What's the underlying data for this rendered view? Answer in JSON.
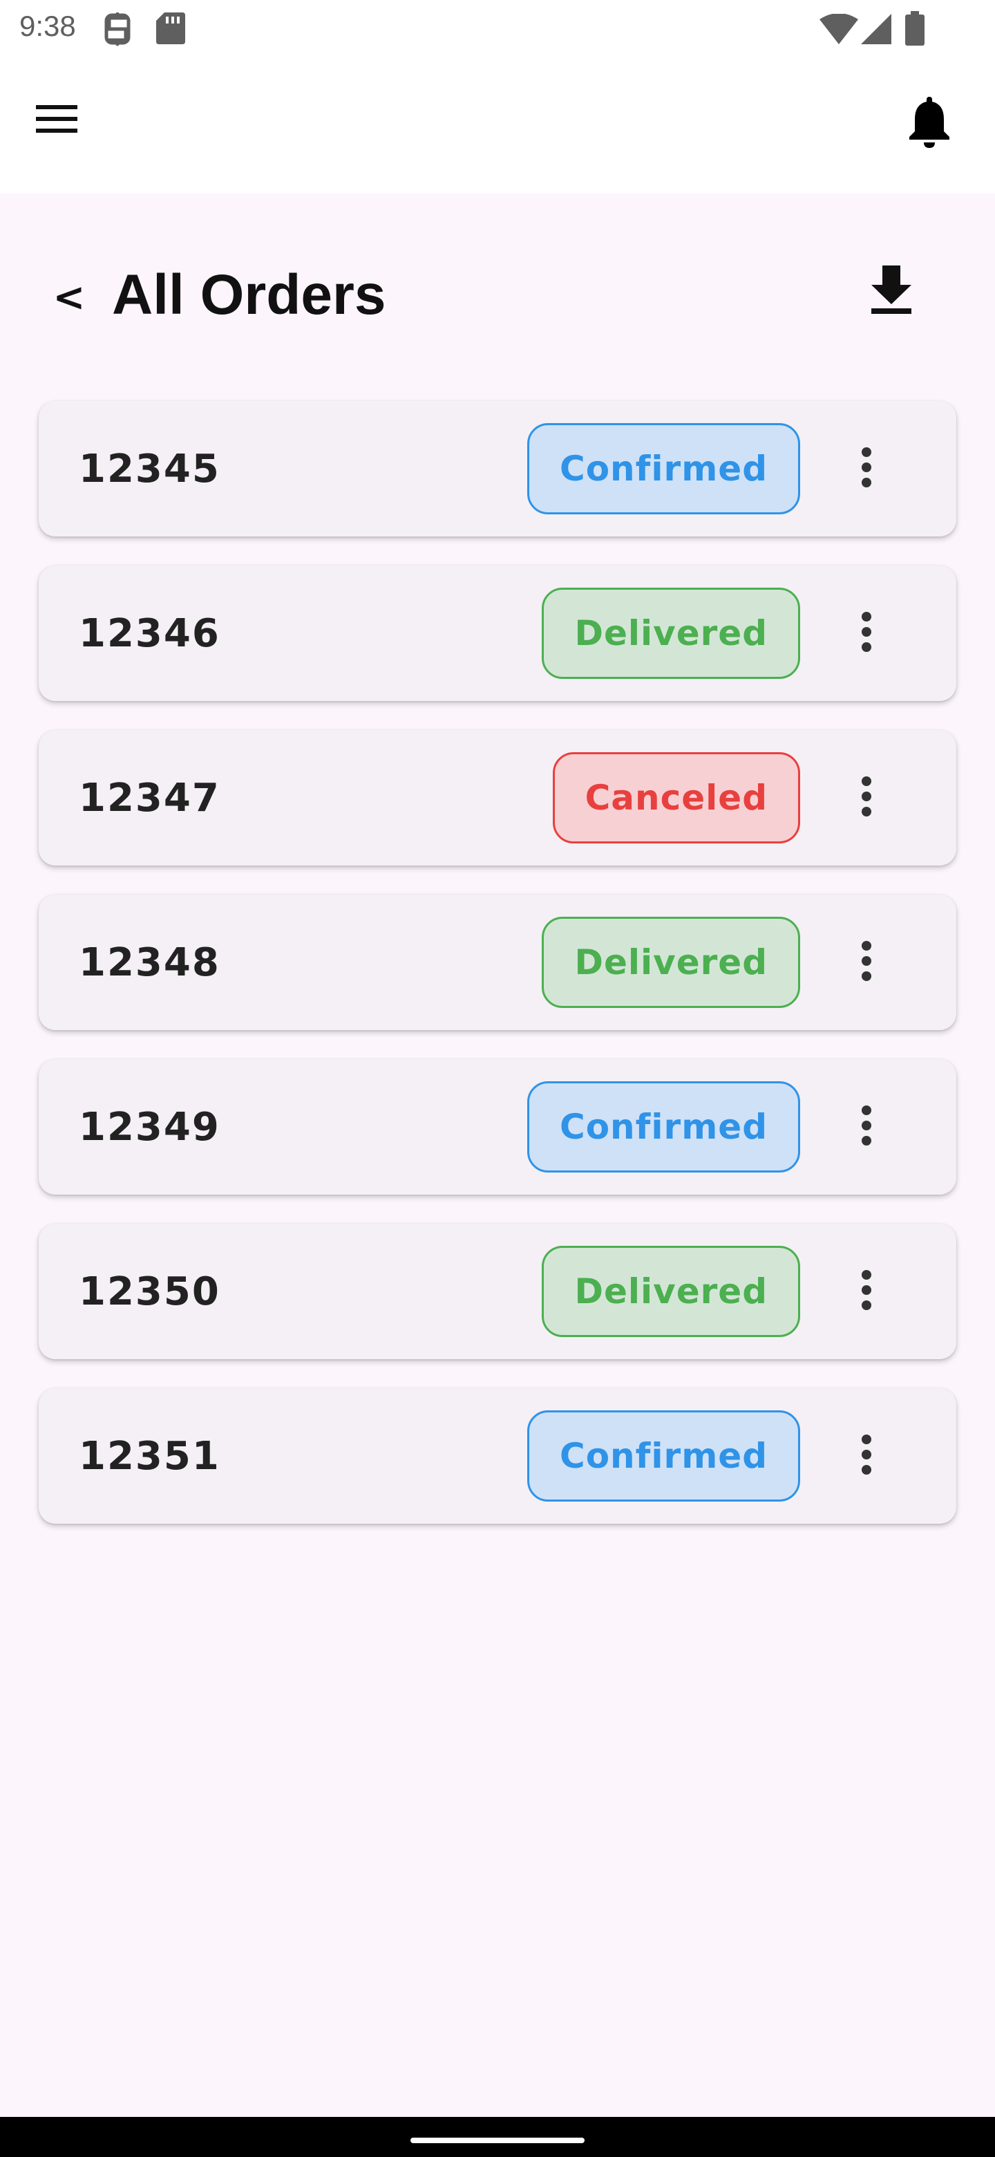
{
  "status_bar": {
    "time": "9:38",
    "icons": [
      "sim-toolkit-icon",
      "sd-card-icon",
      "wifi-icon",
      "signal-icon",
      "battery-icon"
    ]
  },
  "app_bar": {
    "menu_icon": "hamburger-menu-icon",
    "notification_icon": "bell-icon"
  },
  "page": {
    "back_label": "<",
    "title": "All Orders",
    "download_icon": "download-icon"
  },
  "orders": [
    {
      "id": "12345",
      "status": "Confirmed"
    },
    {
      "id": "12346",
      "status": "Delivered"
    },
    {
      "id": "12347",
      "status": "Canceled"
    },
    {
      "id": "12348",
      "status": "Delivered"
    },
    {
      "id": "12349",
      "status": "Confirmed"
    },
    {
      "id": "12350",
      "status": "Delivered"
    },
    {
      "id": "12351",
      "status": "Confirmed"
    }
  ],
  "colors": {
    "background": "#fcf5fc",
    "card": "#f4f0f5",
    "confirmed": "#2f93e8",
    "delivered": "#4caf50",
    "canceled": "#e8403e"
  }
}
